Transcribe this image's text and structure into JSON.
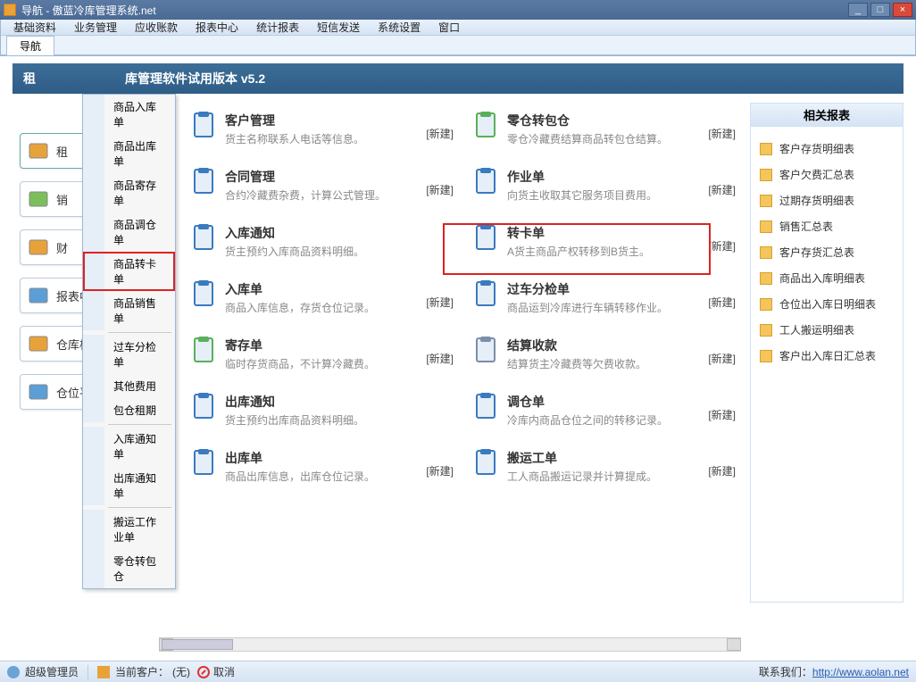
{
  "title": "导航 - 傲蓝冷库管理系统.net",
  "menubar": [
    "基础资料",
    "业务管理",
    "应收账款",
    "报表中心",
    "统计报表",
    "短信发送",
    "系统设置",
    "窗口"
  ],
  "tab": "导航",
  "headerTitle": "库管理软件试用版本 v5.2",
  "headerPrefix": "租",
  "leftNav": [
    {
      "label": "租",
      "key": "rent"
    },
    {
      "label": "销",
      "key": "sale"
    },
    {
      "label": "财",
      "key": "fin"
    },
    {
      "label": "报表中心",
      "key": "report"
    },
    {
      "label": "仓库板位",
      "key": "slot"
    },
    {
      "label": "仓位平面图",
      "key": "plan"
    }
  ],
  "dropdown": [
    {
      "label": "商品入库单"
    },
    {
      "label": "商品出库单"
    },
    {
      "label": "商品寄存单"
    },
    {
      "label": "商品调仓单"
    },
    {
      "label": "商品转卡单",
      "highlight": true
    },
    {
      "label": "商品销售单"
    },
    {
      "sep": true
    },
    {
      "label": "过车分检单"
    },
    {
      "label": "其他费用"
    },
    {
      "label": "包仓租期"
    },
    {
      "sep": true
    },
    {
      "label": "入库通知单"
    },
    {
      "label": "出库通知单"
    },
    {
      "sep": true
    },
    {
      "label": "搬运工作业单"
    },
    {
      "label": "零仓转包仓"
    }
  ],
  "funcs": [
    {
      "title": "客户管理",
      "desc": "货主名称联系人电话等信息。",
      "new": "[新建]"
    },
    {
      "title": "零仓转包仓",
      "desc": "零仓冷藏费结算商品转包仓结算。",
      "new": "[新建]"
    },
    {
      "title": "合同管理",
      "desc": "合约冷藏费杂费，计算公式管理。",
      "new": "[新建]"
    },
    {
      "title": "作业单",
      "desc": "向货主收取其它服务项目费用。",
      "new": "[新建]"
    },
    {
      "title": "入库通知",
      "desc": "货主预约入库商品资料明细。",
      "new": ""
    },
    {
      "title": "转卡单",
      "desc": "A货主商品产权转移到B货主。",
      "new": "[新建]",
      "highlight": true
    },
    {
      "title": "入库单",
      "desc": "商品入库信息，存货仓位记录。",
      "new": "[新建]"
    },
    {
      "title": "过车分检单",
      "desc": "商品运到冷库进行车辆转移作业。",
      "new": "[新建]"
    },
    {
      "title": "寄存单",
      "desc": "临时存货商品，不计算冷藏费。",
      "new": "[新建]"
    },
    {
      "title": "结算收款",
      "desc": "结算货主冷藏费等欠费收款。",
      "new": "[新建]"
    },
    {
      "title": "出库通知",
      "desc": "货主预约出库商品资料明细。",
      "new": ""
    },
    {
      "title": "调仓单",
      "desc": "冷库内商品仓位之间的转移记录。",
      "new": "[新建]"
    },
    {
      "title": "出库单",
      "desc": "商品出库信息，出库仓位记录。",
      "new": "[新建]"
    },
    {
      "title": "搬运工单",
      "desc": "工人商品搬运记录并计算提成。",
      "new": "[新建]"
    }
  ],
  "rightPanel": {
    "title": "相关报表",
    "items": [
      "客户存货明细表",
      "客户欠费汇总表",
      "过期存货明细表",
      "销售汇总表",
      "客户存货汇总表",
      "商品出入库明细表",
      "仓位出入库日明细表",
      "工人搬运明细表",
      "客户出入库日汇总表"
    ]
  },
  "status": {
    "role": "超级管理员",
    "customerLabel": "当前客户：",
    "customerValue": "(无)",
    "cancel": "取消",
    "contactLabel": "联系我们：",
    "url": "http://www.aolan.net"
  }
}
